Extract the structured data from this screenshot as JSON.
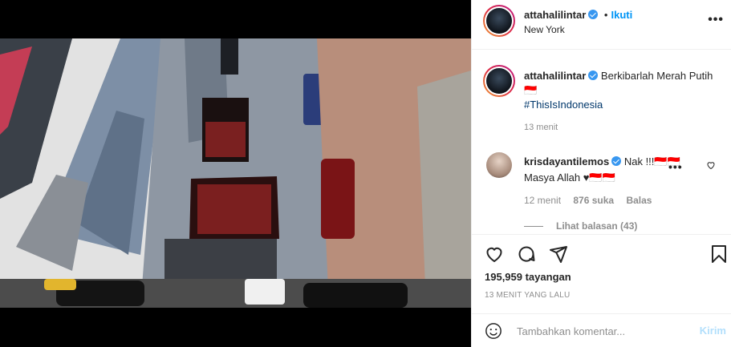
{
  "post": {
    "username": "attahalilintar",
    "follow_label": "Ikuti",
    "dot": "•",
    "location": "New York",
    "more_label": "•••"
  },
  "caption": {
    "username": "attahalilintar",
    "text": "Berkibarlah Merah Putih 🇮🇩",
    "hashtag": "#ThisIsIndonesia",
    "time": "13 menit"
  },
  "comment": {
    "username": "krisdayantilemos",
    "text": "Nak !!!🇮🇩🇮🇩 Masya Allah ♥🇮🇩🇮🇩",
    "time": "12 menit",
    "likes": "876 suka",
    "reply_label": "Balas",
    "more_label": "•••",
    "view_replies": "Lihat balasan (43)"
  },
  "stats": {
    "views": "195,959 tayangan",
    "time_ago": "13 MENIT YANG LALU"
  },
  "comment_box": {
    "placeholder": "Tambahkan komentar...",
    "post_label": "Kirim"
  },
  "icons": {
    "like": "heart-icon",
    "comment": "comment-icon",
    "share": "share-icon",
    "save": "bookmark-icon",
    "emoji": "emoji-icon",
    "mute": "muted-speaker-icon"
  },
  "colors": {
    "accent": "#0095f6",
    "post_disabled": "#b2dffc",
    "muted_text": "#8e8e8e"
  }
}
